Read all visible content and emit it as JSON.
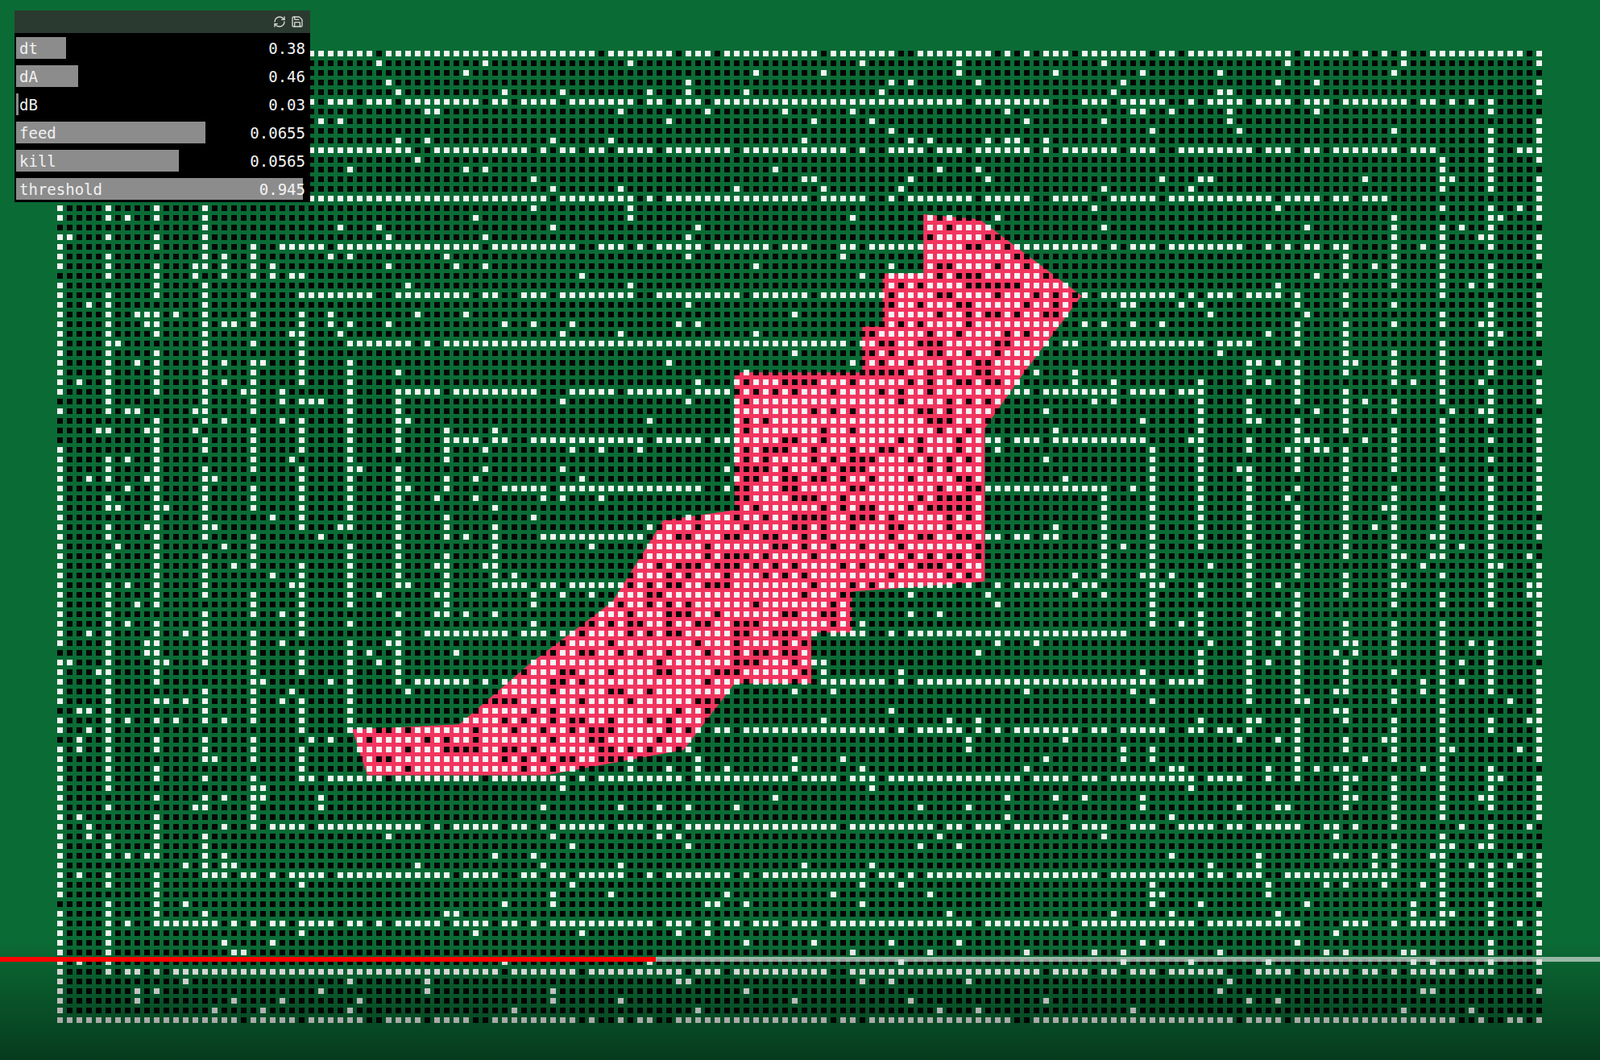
{
  "gui": {
    "controls": [
      {
        "label": "dt",
        "value": "0.38",
        "level": 0.18
      },
      {
        "label": "dA",
        "value": "0.46",
        "level": 0.22
      },
      {
        "label": "dB",
        "value": "0.03",
        "level": 0.02
      },
      {
        "label": "feed",
        "value": "0.0655",
        "level": 0.65
      },
      {
        "label": "kill",
        "value": "0.0565",
        "level": 0.56
      },
      {
        "label": "threshold",
        "value": "0.945",
        "level": 0.98
      }
    ]
  },
  "video_progress": {
    "level": 0.41,
    "buffered": 1.0
  }
}
